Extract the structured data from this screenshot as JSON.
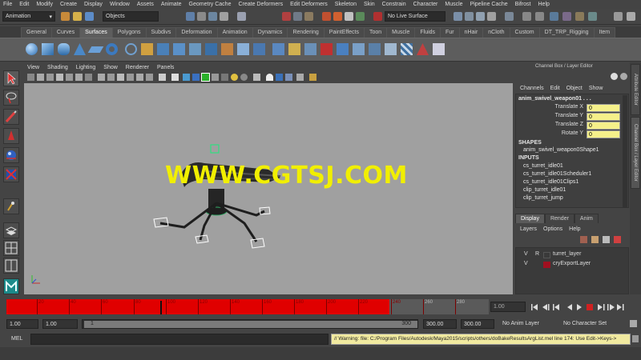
{
  "menubar": [
    "File",
    "Edit",
    "Modify",
    "Create",
    "Display",
    "Window",
    "Assets",
    "Animate",
    "Geometry Cache",
    "Create Deformers",
    "Edit Deformers",
    "Skeleton",
    "Skin",
    "Constrain",
    "Character",
    "Muscle",
    "Pipeline Cache",
    "Bifrost",
    "Help"
  ],
  "status": {
    "module": "Animation",
    "selection_mode": "Objects",
    "live_surface": "No Live Surface"
  },
  "shelf_tabs": [
    "General",
    "Curves",
    "Surfaces",
    "Polygons",
    "Subdivs",
    "Deformation",
    "Animation",
    "Dynamics",
    "Rendering",
    "PaintEffects",
    "Toon",
    "Muscle",
    "Fluids",
    "Fur",
    "nHair",
    "nCloth",
    "Custom",
    "DT_TRP_Rigging",
    "Item"
  ],
  "active_shelf_tab": "Surfaces",
  "viewport_menu": [
    "View",
    "Shading",
    "Lighting",
    "Show",
    "Renderer",
    "Panels"
  ],
  "watermark": "WWW.CGTSJ.COM",
  "channel_box": {
    "title": "Channel Box / Layer Editor",
    "menu": [
      "Channels",
      "Edit",
      "Object",
      "Show"
    ],
    "object_name": "anim_swivel_weapon01 . . .",
    "attributes": [
      {
        "label": "Translate X",
        "value": "0"
      },
      {
        "label": "Translate Y",
        "value": "0"
      },
      {
        "label": "Translate Z",
        "value": "0"
      },
      {
        "label": "Rotate Y",
        "value": "0"
      }
    ],
    "shapes_header": "SHAPES",
    "shapes": [
      "anim_swivel_weapon0Shape1"
    ],
    "inputs_header": "INPUTS",
    "inputs": [
      "cs_turret_idle01",
      "cs_turret_idle01Scheduler1",
      "cs_turret_idle01Clips1",
      "clip_turret_idle01",
      "clip_turret_jump"
    ]
  },
  "sidebar_tabs": [
    "Attribute Editor",
    "Channel Box / Layer Editor"
  ],
  "layer_editor": {
    "tabs": [
      "Display",
      "Render",
      "Anim"
    ],
    "active_tab": "Display",
    "menu": [
      "Layers",
      "Options",
      "Help"
    ],
    "layers": [
      {
        "v": "V",
        "r": "R",
        "name": "turret_layer",
        "color": "#3a3a3a"
      },
      {
        "v": "V",
        "r": "",
        "name": "cryExportLayer",
        "color": "#a01020"
      }
    ]
  },
  "timeline": {
    "ticks": [
      "20",
      "40",
      "60",
      "80",
      "100",
      "120",
      "140",
      "160",
      "180",
      "200",
      "220",
      "240",
      "260",
      "280"
    ],
    "current_frame": "1.00",
    "keyed_color": "#e00000"
  },
  "range": {
    "start": "1.00",
    "playback_start": "1.00",
    "slider_start": "1",
    "slider_end": "300",
    "playback_end": "300.00",
    "end": "300.00",
    "anim_layer": "No Anim Layer",
    "character_set": "No Character Set"
  },
  "command": {
    "label": "MEL",
    "warning": "// Warning: file: C:/Program Files/Autodesk/Maya2015/scripts/others/doBakeResultsArgList.mel line 174: Use Edit->Keys->"
  }
}
